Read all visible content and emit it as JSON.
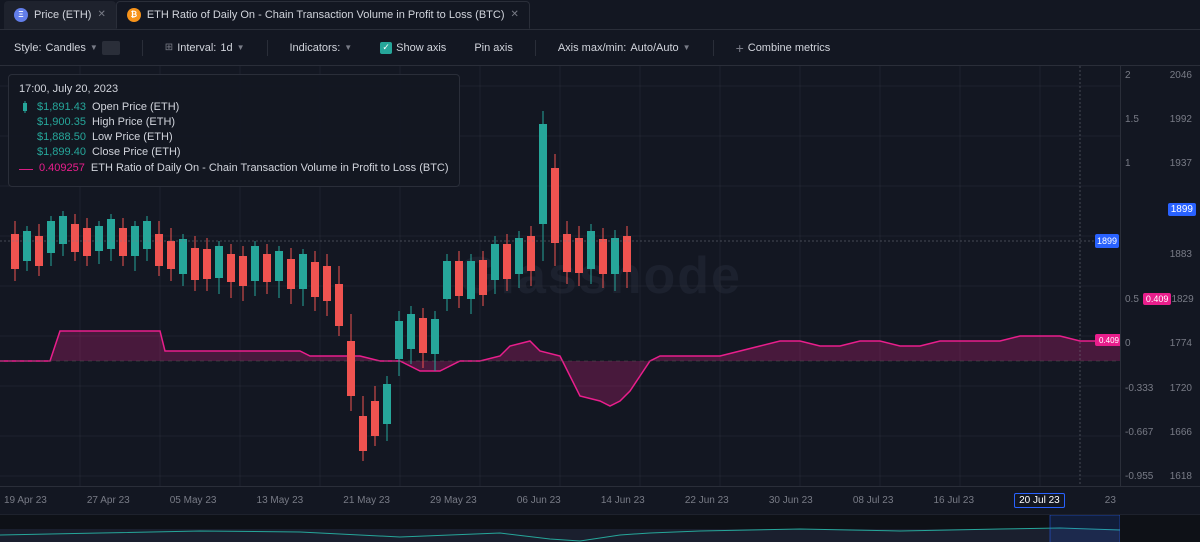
{
  "tabs": [
    {
      "id": "price-eth",
      "icon": "eth",
      "label": "Price (ETH)",
      "closable": true,
      "active": false
    },
    {
      "id": "ratio-btc",
      "icon": "btc",
      "label": "ETH Ratio of Daily On - Chain Transaction Volume in Profit to Loss (BTC)",
      "closable": true,
      "active": true
    }
  ],
  "toolbar": {
    "style_label": "Style:",
    "style_value": "Candles",
    "interval_label": "Interval:",
    "interval_value": "1d",
    "indicators_label": "Indicators:",
    "show_axis_label": "Show axis",
    "pin_axis_label": "Pin axis",
    "axis_maxmin_label": "Axis max/min:",
    "axis_maxmin_value": "Auto/Auto",
    "combine_metrics_label": "Combine metrics"
  },
  "tooltip": {
    "date": "17:00, July 20, 2023",
    "rows": [
      {
        "type": "ohlc",
        "label": "Open Price (ETH)",
        "value": "$1,891.43",
        "color": "green"
      },
      {
        "type": "ohlc",
        "label": "High Price (ETH)",
        "value": "$1,900.35",
        "color": "green"
      },
      {
        "type": "ohlc",
        "label": "Low Price (ETH)",
        "value": "$1,888.50",
        "color": "green"
      },
      {
        "type": "ohlc",
        "label": "Close Price (ETH)",
        "value": "$1,899.40",
        "color": "green"
      },
      {
        "type": "ratio",
        "label": "ETH Ratio of Daily On - Chain Transaction Volume in Profit to Loss (BTC)",
        "value": "0.409257",
        "color": "pink"
      }
    ]
  },
  "y_axis": {
    "price_labels": [
      "2046",
      "1992",
      "1937",
      "1899",
      "1883",
      "1829",
      "1774",
      "1720",
      "1666",
      "1618"
    ],
    "ratio_labels": [
      "2",
      "1.5",
      "1",
      "0.5",
      "0",
      "-0.333",
      "-0.667",
      "-0.955"
    ],
    "highlighted_price": "1899",
    "highlighted_ratio": "0.409"
  },
  "x_axis": {
    "labels": [
      "19 Apr 23",
      "27 Apr 23",
      "05 May 23",
      "13 May 23",
      "21 May 23",
      "29 May 23",
      "06 Jun 23",
      "14 Jun 23",
      "22 Jun 23",
      "30 Jun 23",
      "08 Jul 23",
      "16 Jul 23",
      "20 Jul 23",
      "23"
    ],
    "highlighted": "20 Jul 23"
  },
  "watermark": "Glassnode"
}
